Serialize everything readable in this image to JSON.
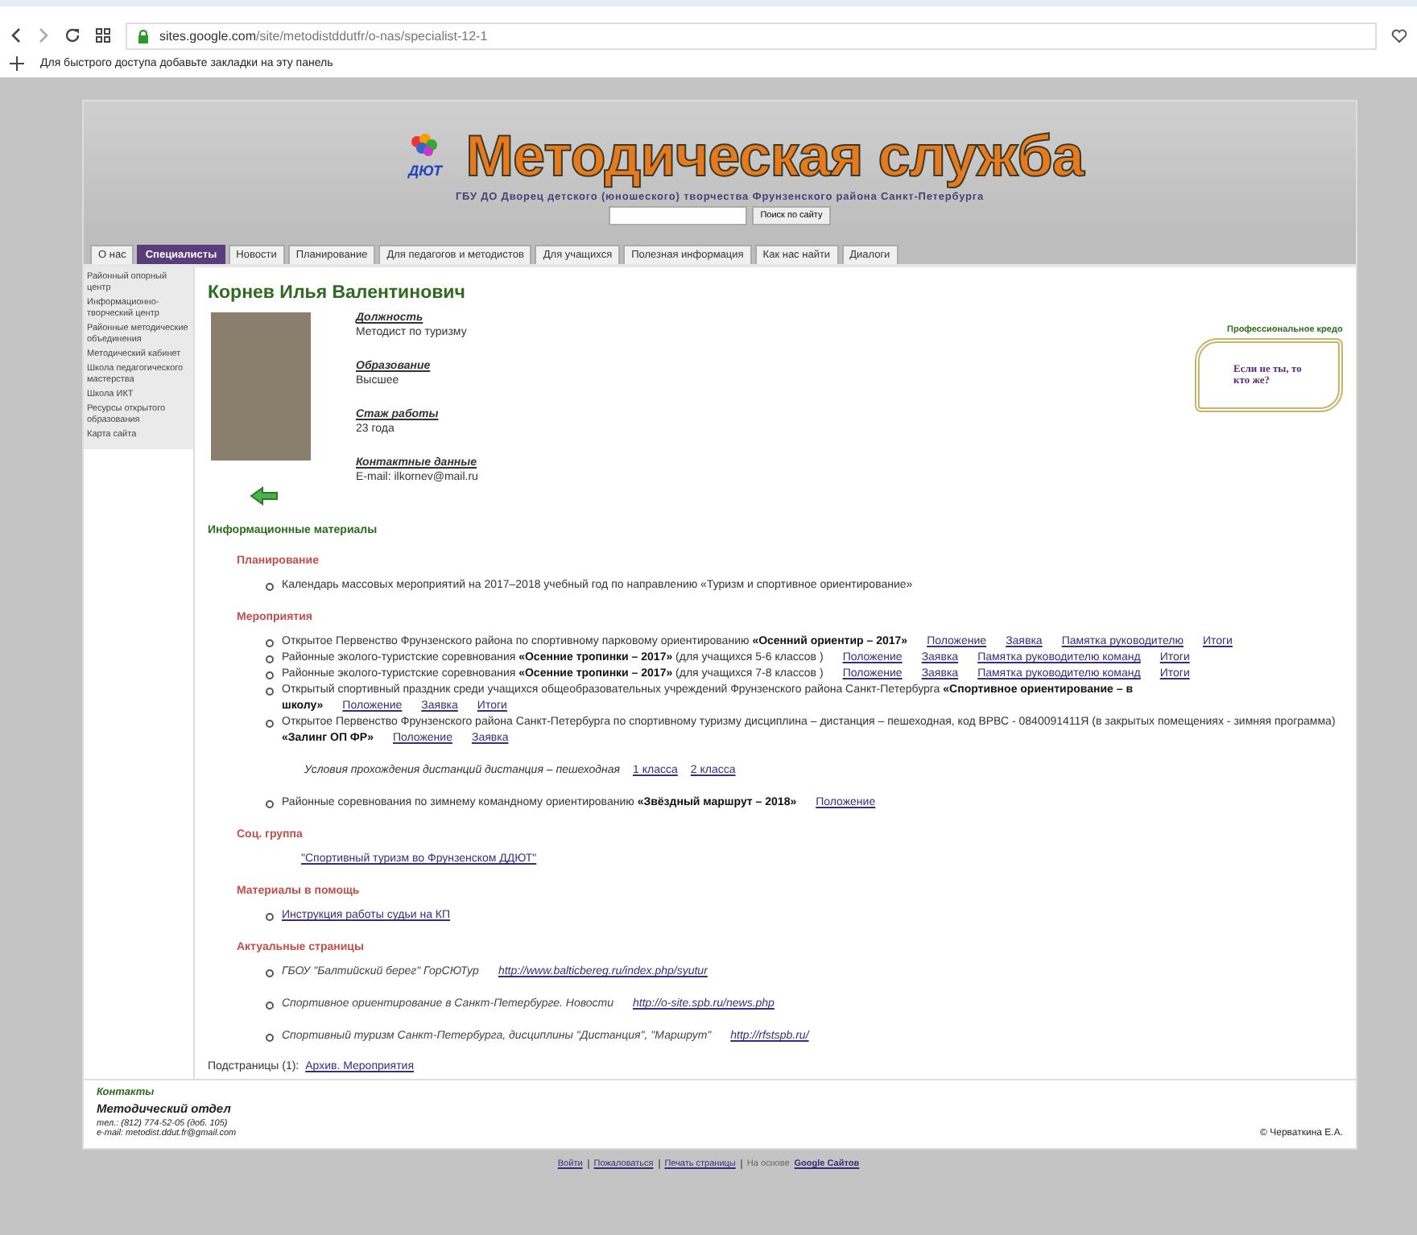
{
  "browser": {
    "url_host": "sites.google.com",
    "url_path": "/site/metodistddutfr/o-nas/specialist-12-1",
    "bookmarks_hint": "Для быстрого доступа добавьте закладки на эту панель"
  },
  "site": {
    "title": "Методическая служба",
    "logo_text": "ДЮТ",
    "subtitle": "ГБУ ДО Дворец детского (юношеского) творчества Фрунзенского района Санкт-Петербурга",
    "search_button": "Поиск по сайту",
    "tabs": [
      {
        "label": "О нас",
        "selected": false
      },
      {
        "label": "Специалисты",
        "selected": true
      },
      {
        "label": "Новости",
        "selected": false
      },
      {
        "label": "Планирование",
        "selected": false
      },
      {
        "label": "Для педагогов и методистов",
        "selected": false
      },
      {
        "label": "Для учащихся",
        "selected": false
      },
      {
        "label": "Полезная информация",
        "selected": false
      },
      {
        "label": "Как нас найти",
        "selected": false
      },
      {
        "label": "Диалоги",
        "selected": false
      }
    ],
    "sidebar": {
      "items": [
        "Районный опорный центр",
        "Информационно-творческий центр",
        "Районные методические объединения",
        "Методический кабинет",
        "Школа педагогического мастерства",
        "Школа ИКТ",
        "Ресурсы открытого образования",
        "Карта сайта"
      ]
    }
  },
  "person": {
    "name": "Корнев Илья Валентинович",
    "fields": [
      {
        "label": "Должность",
        "value": "Методист по туризму"
      },
      {
        "label": "Образование",
        "value": "Высшее"
      },
      {
        "label": "Стаж работы",
        "value": "23 года"
      },
      {
        "label": "Контактные данные",
        "value": "E-mail: ilkornev@mail.ru"
      }
    ],
    "credo": {
      "heading": "Профессиональное кредо",
      "text": "Если не ты, то кто же?"
    }
  },
  "materials": {
    "heading": "Информационные материалы",
    "sections": [
      {
        "heading": "Планирование",
        "items": [
          {
            "kind": "bullet",
            "text": "Календарь массовых мероприятий на 2017–2018 учебный год по направлению «Туризм и спортивное ориентирование»"
          }
        ]
      },
      {
        "heading": "Мероприятия",
        "items": [
          {
            "kind": "bullet",
            "text": "Открытое Первенство Фрунзенского района по спортивному парковому ориентированию **«Осенний ориентир – 2017»**",
            "links": [
              "Положение",
              "Заявка",
              "Памятка руководителю",
              "Итоги"
            ]
          },
          {
            "kind": "bullet",
            "text": "Районные эколого-туристские соревнования **«Осенние тропинки – 2017»** (для учащихся 5-6 классов )",
            "links": [
              "Положение",
              "Заявка",
              "Памятка руководителю команд",
              "Итоги"
            ]
          },
          {
            "kind": "bullet",
            "text": "Районные эколого-туристские соревнования **«Осенние тропинки – 2017»** (для учащихся 7-8 классов )",
            "links": [
              "Положение",
              "Заявка",
              "Памятка руководителю команд",
              "Итоги"
            ]
          },
          {
            "kind": "bullet",
            "text": "Открытый спортивный праздник среди учащихся общеобразовательных учреждений Фрунзенского района Санкт-Петербурга **«Спортивное ориентирование – в школу»**",
            "links": [
              "Положение",
              "Заявка",
              "Итоги"
            ]
          },
          {
            "kind": "bullet",
            "text": "Открытое Первенство Фрунзенского района Санкт-Петербурга по спортивному туризму дисциплина – дистанция – пешеходная, код ВРВС - 0840091411Я (в закрытых помещениях - зимняя программа) **«Залинг ОП ФР»**",
            "links": [
              "Положение",
              "Заявка"
            ]
          },
          {
            "kind": "note",
            "text": "Условия прохождения дистанций дистанция – пешеходная",
            "links": [
              "1 класса",
              "2 класса"
            ]
          },
          {
            "kind": "bullet",
            "text": "Районные соревнования по зимнему командному ориентированию **«Звёздный маршрут – 2018»**",
            "links": [
              "Положение"
            ]
          }
        ]
      },
      {
        "heading": "Соц. группа",
        "items": [
          {
            "kind": "indent",
            "links": [
              "\"Спортивный туризм во Фрунзенском ДДЮТ\""
            ]
          }
        ]
      },
      {
        "heading": "Материалы в помощь",
        "items": [
          {
            "kind": "bullet",
            "links": [
              "Инструкция работы судьи на КП"
            ]
          }
        ]
      },
      {
        "heading": "Актуальные страницы",
        "items": [
          {
            "kind": "italic",
            "text": "ГБОУ \"Балтийский берег\" ГорСЮТур",
            "links": [
              "http://www.balticbereg.ru/index.php/syutur"
            ]
          },
          {
            "kind": "italic",
            "text": "Спортивное ориентирование в Санкт-Петербурге. Новости",
            "links": [
              "http://o-site.spb.ru/news.php"
            ]
          },
          {
            "kind": "italic",
            "text": "Спортивный туризм Санкт-Петербурга, дисциплины \"Дистанция\", \"Маршрут\"",
            "links": [
              "http://rfstspb.ru/"
            ]
          }
        ]
      }
    ]
  },
  "subpages": {
    "label": "Подстраницы (1):",
    "link": "Архив. Мероприятия"
  },
  "footer": {
    "heading": "Контакты",
    "department": "Методический отдел",
    "phone": "тел.: (812) 774-52-05 (доб. 105)",
    "email": "e-mail: metodist.ddut.fr@gmail.com",
    "copyright": "© Черваткина Е.А."
  },
  "bottom_bar": {
    "links": [
      "Войти",
      "Пожаловаться",
      "Печать страницы"
    ],
    "powered_label": "На основе",
    "powered_link": "Google Сайтов"
  }
}
